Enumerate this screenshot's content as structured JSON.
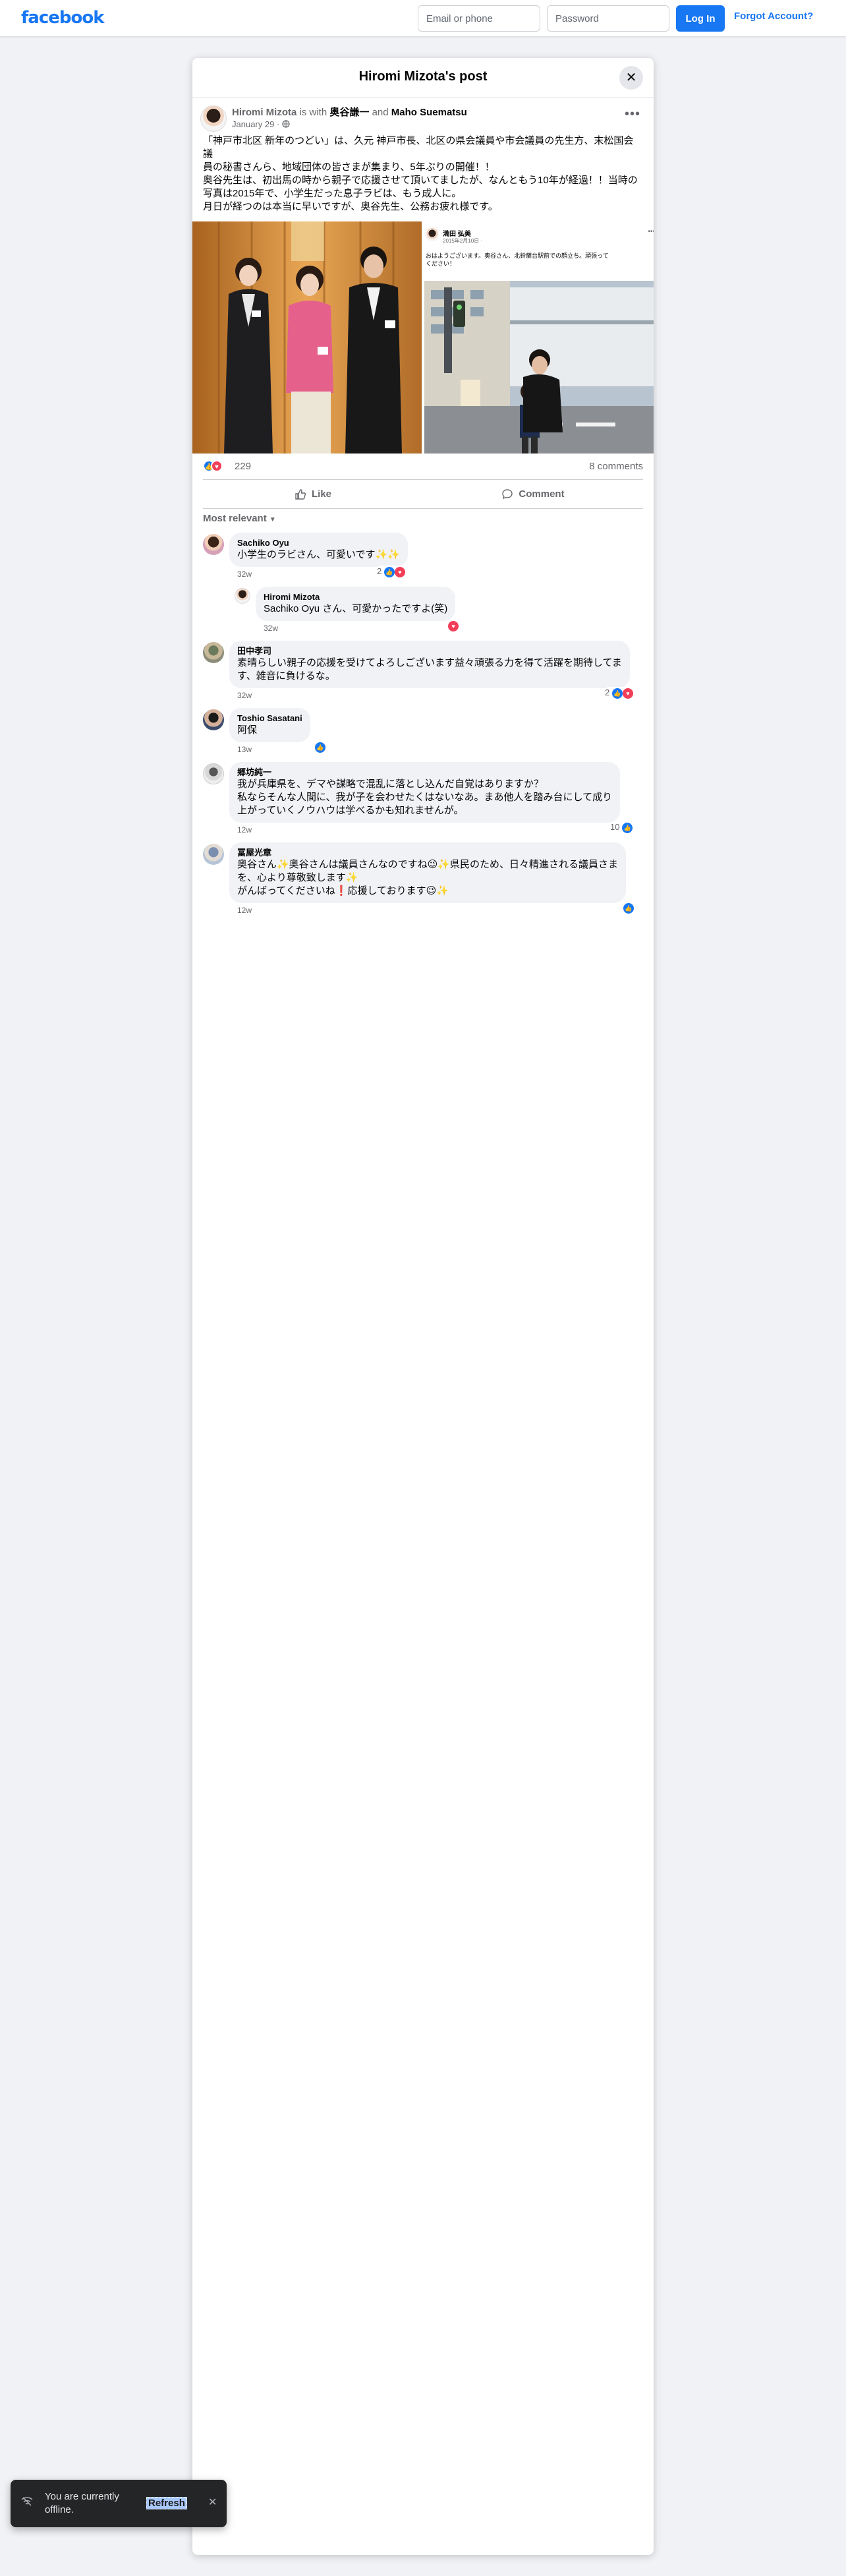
{
  "topbar": {
    "logo": "facebook",
    "email_placeholder": "Email or phone",
    "password_placeholder": "Password",
    "login_label": "Log In",
    "forgot_label": "Forgot Account?"
  },
  "dialog": {
    "title": "Hiromi Mizota's post",
    "close_icon": "close-icon"
  },
  "post": {
    "author": "Hiromi Mizota",
    "with_text": "is with",
    "tag1": "奥谷謙一",
    "and_text": "and",
    "tag2": "Maho Suematsu",
    "date": "January 29",
    "audience_icon": "globe-icon",
    "text_lines": [
      "「神戸市北区 新年のつどい」は、久元 神戸市長、北区の県会議員や市会議員の先生方、末松国会議",
      "員の秘書さんら、地域団体の皆さまが集まり、5年ぶりの開催！！",
      "奥谷先生は、初出馬の時から親子で応援させて頂いてましたが、なんともう10年が経過！！当時の",
      "写真は2015年で、小学生だった息子ラビは、もう成人に。",
      "月日が経つのは本当に早いですが、奥谷先生、公務お疲れ様です。"
    ],
    "photo_right": {
      "author": "満田 弘美",
      "date": "2015年2月10日 ·",
      "caption_line1": "おはようございます。奥谷さん、北鈴蘭台駅前での顔立ち。頑張って",
      "caption_line2": "ください！"
    }
  },
  "stats": {
    "reaction_count": "229",
    "comment_count": "8 comments"
  },
  "actions": {
    "like_label": "Like",
    "comment_label": "Comment"
  },
  "sort_label": "Most relevant",
  "comments": [
    {
      "name": "Sachiko Oyu",
      "text": "小学生のラビさん、可愛いです✨✨",
      "time": "32w",
      "reactions": "2"
    },
    {
      "name": "Hiromi Mizota",
      "text": "Sachiko Oyu さん、可愛かったですよ(笑)",
      "time": "32w",
      "reactions": ""
    },
    {
      "name": "田中孝司",
      "text": "素晴らしい親子の応援を受けてよろしございます益々頑張る力を得て活躍を期待してます、雑音に負けるな。",
      "time": "32w",
      "reactions": "2"
    },
    {
      "name": "Toshio Sasatani",
      "text": "阿保",
      "time": "13w",
      "reactions": ""
    },
    {
      "name": "郷坊純一",
      "text_lines": [
        "我が兵庫県を、デマや謀略で混乱に落とし込んだ自覚はありますか？",
        "私ならそんな人間に、我が子を会わせたくはないなあ。まあ他人を踏み台にして成り",
        "上がっていくノウハウは学べるかも知れませんが。"
      ],
      "time": "12w",
      "reactions": "10"
    },
    {
      "name": "冨屋光章",
      "text_lines": [
        "奥谷さん✨奥谷さんは議員さんなのですね😉✨県民のため、日々精進される議員さま",
        "を、心より尊敬致します✨",
        "がんばってくださいね❗応援しております😉✨"
      ],
      "time": "12w",
      "reactions": ""
    }
  ],
  "toast": {
    "text": "You are currently offline.",
    "refresh_label": "Refresh"
  }
}
